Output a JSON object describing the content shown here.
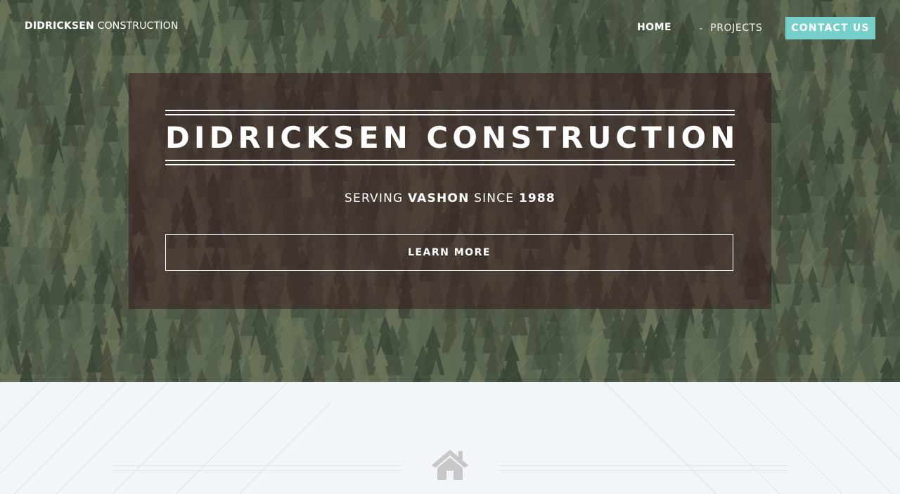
{
  "nav": {
    "brand_bold": "DIDRICKSEN",
    "brand_light": "CONSTRUCTION",
    "home_label": "HOME",
    "projects_label": "PROJECTS",
    "contact_label": "CONTACT US"
  },
  "hero": {
    "title": "DIDRICKSEN CONSTRUCTION",
    "tagline_part1": "SERVING ",
    "tagline_bold1": "VASHON",
    "tagline_part2": " SINCE ",
    "tagline_bold2": "1988",
    "learn_more_label": "LEARN MORE"
  },
  "colors": {
    "accent": "#76cfc9",
    "overlay": "#3a1c20",
    "lower_bg": "#f2f5f9",
    "icon_gray": "#c8c8c8"
  },
  "icons": {
    "projects_dropdown": "chevron-down-icon",
    "section_icon": "home-icon"
  }
}
